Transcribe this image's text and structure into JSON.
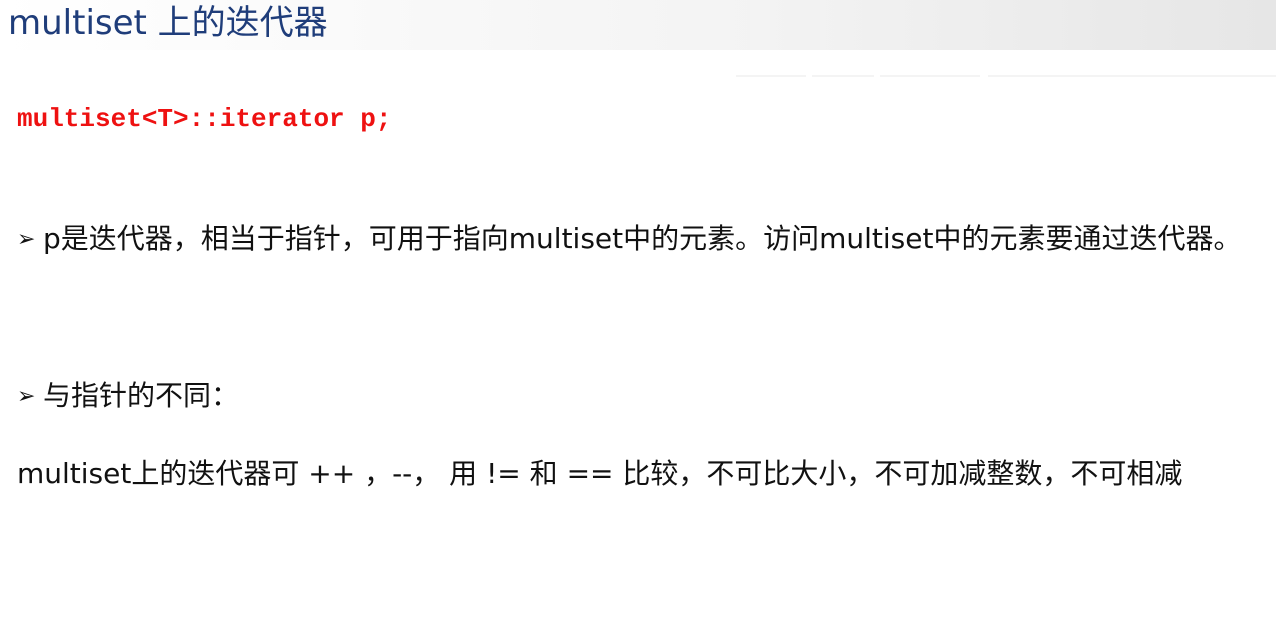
{
  "slide": {
    "title": "multiset 上的迭代器",
    "code": "multiset<T>::iterator p;",
    "bullet_icon": "arrow-bullet-icon",
    "bullet_glyph": "➢",
    "point1": "p是迭代器，相当于指针，可用于指向multiset中的元素。访问multiset中的元素要通过迭代器。",
    "point2": "与指针的不同：",
    "point3": " multiset上的迭代器可 ++ ，--， 用 != 和 == 比较，不可比大小，不可加减整数，不可相减"
  },
  "colors": {
    "title": "#1f3d7a",
    "code": "#ee1111",
    "body": "#111111"
  }
}
